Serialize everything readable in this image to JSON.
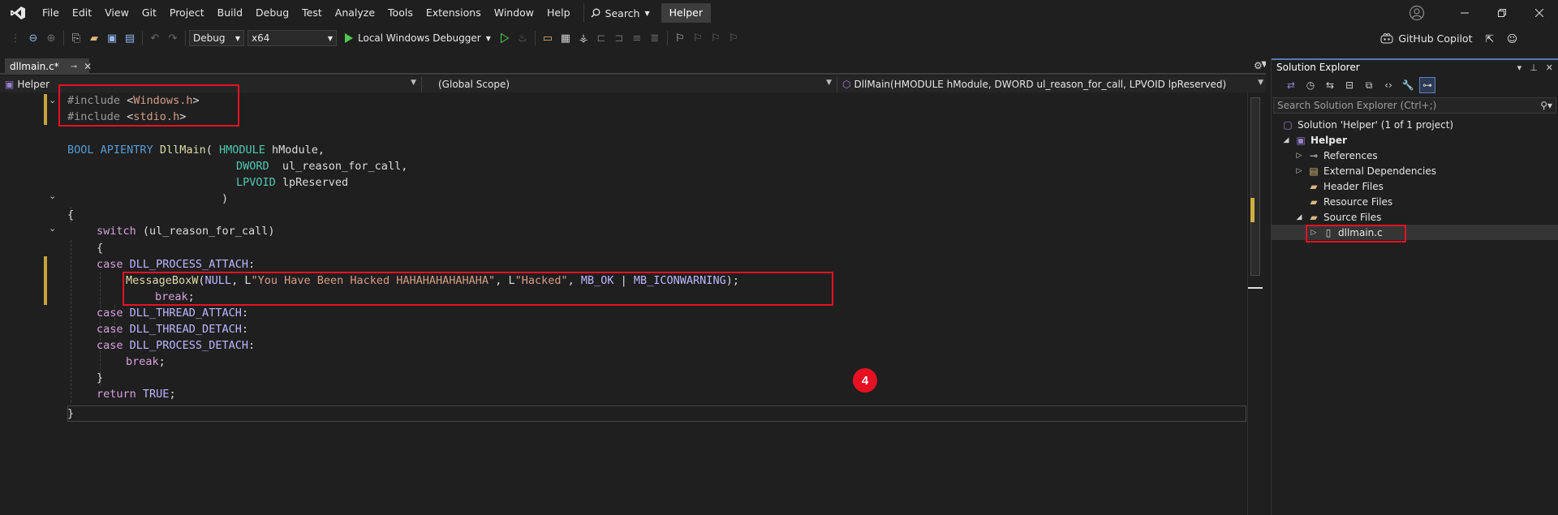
{
  "menu": {
    "items": [
      "File",
      "Edit",
      "View",
      "Git",
      "Project",
      "Build",
      "Debug",
      "Test",
      "Analyze",
      "Tools",
      "Extensions",
      "Window",
      "Help"
    ],
    "search_label": "Search",
    "project_badge": "Helper"
  },
  "toolbar": {
    "config": "Debug",
    "platform": "x64",
    "run_label": "Local Windows Debugger",
    "copilot_label": "GitHub Copilot"
  },
  "editor": {
    "tab_title": "dllmain.c*",
    "nav_project": "Helper",
    "nav_scope": "(Global Scope)",
    "nav_member": "DllMain(HMODULE hModule, DWORD ul_reason_for_call, LPVOID lpReserved)",
    "step_badge": "4",
    "code": {
      "l1_pp": "#include ",
      "l1_open": "<",
      "l1_hdr": "Windows.h",
      "l1_close": ">",
      "l2_pp": "#include ",
      "l2_open": "<",
      "l2_hdr": "stdio.h",
      "l2_close": ">",
      "l4_bool": "BOOL",
      "l4_api": "APIENTRY",
      "l4_fn": "DllMain",
      "l4_paren": "( ",
      "l4_type": "HMODULE",
      "l4_param": " hModule,",
      "l5_type": "DWORD",
      "l5_param": "  ul_reason_for_call,",
      "l6_type": "LPVOID",
      "l6_param": " lpReserved",
      "l7": ")",
      "l8": "{",
      "l9_kw": "switch",
      "l9_rest": " (ul_reason_for_call)",
      "l10": "{",
      "l11_kw": "case",
      "l11_mac": "DLL_PROCESS_ATTACH",
      "l11_colon": ":",
      "l12_fn": "MessageBoxW",
      "l12_p1": "(",
      "l12_null": "NULL",
      "l12_p2": ", L",
      "l12_s1": "\"You Have Been Hacked HAHAHAHAHAHAHA\"",
      "l12_p3": ", L",
      "l12_s2": "\"Hacked\"",
      "l12_p4": ", ",
      "l12_m1": "MB_OK",
      "l12_p5": " | ",
      "l12_m2": "MB_ICONWARNING",
      "l12_p6": ");",
      "l13_kw": "break",
      "l13_semi": ";",
      "l14_kw": "case",
      "l14_mac": "DLL_THREAD_ATTACH",
      "l14_colon": ":",
      "l15_kw": "case",
      "l15_mac": "DLL_THREAD_DETACH",
      "l15_colon": ":",
      "l16_kw": "case",
      "l16_mac": "DLL_PROCESS_DETACH",
      "l16_colon": ":",
      "l17_kw": "break",
      "l17_semi": ";",
      "l18": "}",
      "l19_kw": "return",
      "l19_mac": "TRUE",
      "l19_semi": ";",
      "l20": "}"
    }
  },
  "solution_explorer": {
    "title": "Solution Explorer",
    "search_placeholder": "Search Solution Explorer (Ctrl+;)",
    "tree": {
      "solution": "Solution 'Helper' (1 of 1 project)",
      "project": "Helper",
      "references": "References",
      "external": "External Dependencies",
      "headers": "Header Files",
      "resources": "Resource Files",
      "sources": "Source Files",
      "file": "dllmain.c"
    }
  },
  "colors": {
    "annotation_red": "#e81123",
    "keyword": "#569cd6",
    "control": "#d8a0df",
    "function": "#dcdcaa",
    "string": "#d69d85",
    "macro": "#beb7ff"
  }
}
